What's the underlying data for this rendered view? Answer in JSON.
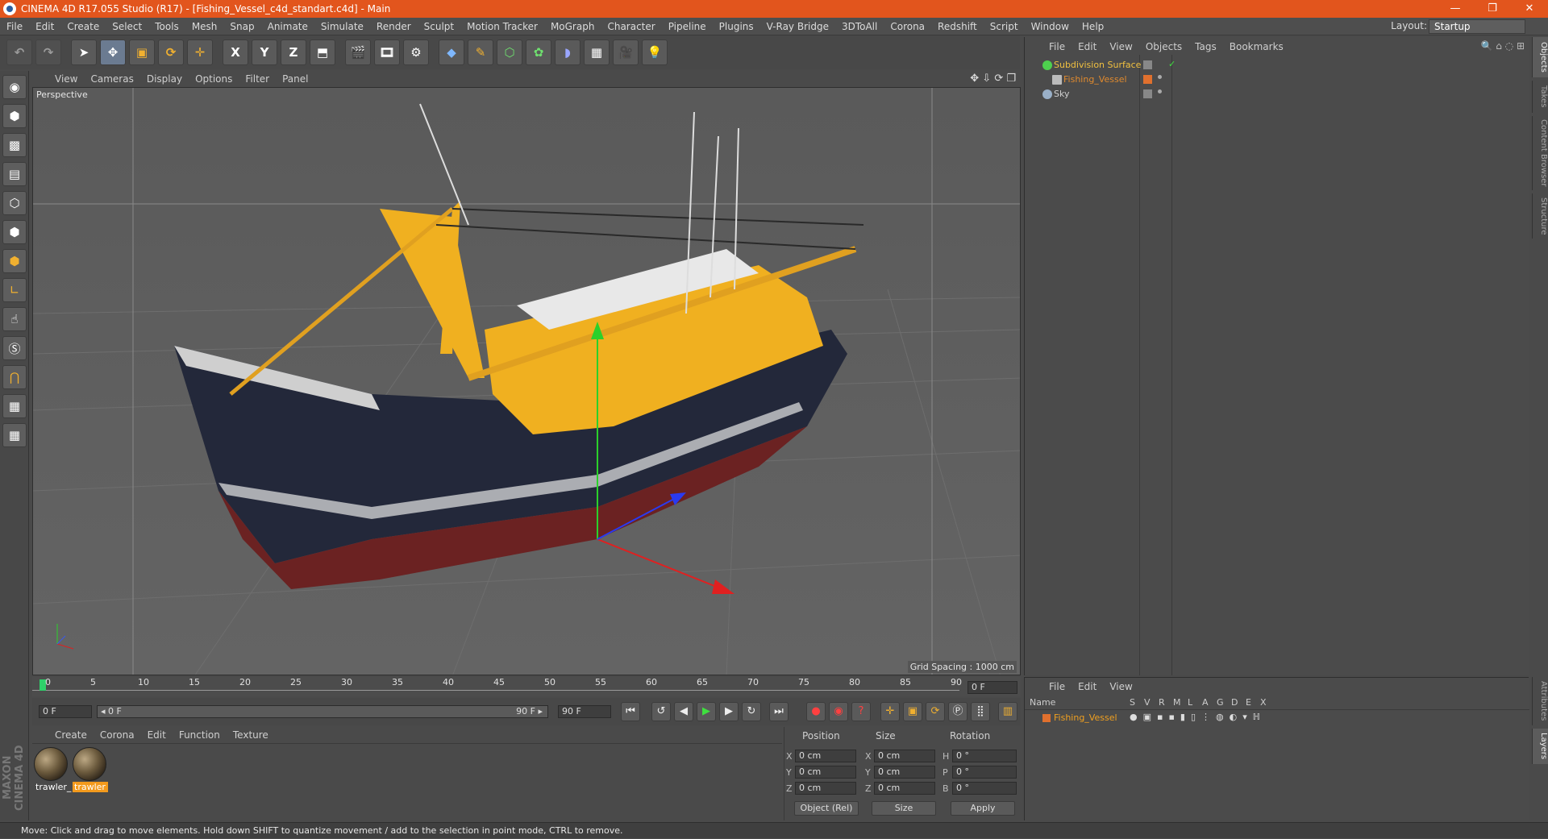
{
  "window": {
    "title": "CINEMA 4D R17.055 Studio (R17) - [Fishing_Vessel_c4d_standart.c4d] - Main",
    "minimize": "—",
    "restore": "❐",
    "close": "✕"
  },
  "menu": [
    "File",
    "Edit",
    "Create",
    "Select",
    "Tools",
    "Mesh",
    "Snap",
    "Animate",
    "Simulate",
    "Render",
    "Sculpt",
    "Motion Tracker",
    "MoGraph",
    "Character",
    "Pipeline",
    "Plugins",
    "V-Ray Bridge",
    "3DToAll",
    "Corona",
    "Redshift",
    "Script",
    "Window",
    "Help"
  ],
  "layout": {
    "label": "Layout:",
    "value": "Startup"
  },
  "toolbar": {
    "axes": [
      "X",
      "Y",
      "Z"
    ]
  },
  "viewport": {
    "menu": [
      "View",
      "Cameras",
      "Display",
      "Options",
      "Filter",
      "Panel"
    ],
    "label": "Perspective",
    "grid_spacing": "Grid Spacing : 1000 cm"
  },
  "timeline": {
    "ticks": [
      "0",
      "5",
      "10",
      "15",
      "20",
      "25",
      "30",
      "35",
      "40",
      "45",
      "50",
      "55",
      "60",
      "65",
      "70",
      "75",
      "80",
      "85",
      "90"
    ],
    "current_frame": "0 F",
    "start_field": "0 F",
    "range_start": "◂ 0 F",
    "range_end": "90 F ▸",
    "end_field": "90 F"
  },
  "material_manager": {
    "menu": [
      "Create",
      "Corona",
      "Edit",
      "Function",
      "Texture"
    ],
    "materials": [
      {
        "label": "trawler_"
      },
      {
        "label": "trawler"
      }
    ]
  },
  "coords": {
    "headers": {
      "position": "Position",
      "size": "Size",
      "rotation": "Rotation"
    },
    "rows": [
      {
        "axis": "X",
        "pos": "0 cm",
        "saxis": "X",
        "size": "0 cm",
        "raxis": "H",
        "rot": "0 °"
      },
      {
        "axis": "Y",
        "pos": "0 cm",
        "saxis": "Y",
        "size": "0 cm",
        "raxis": "P",
        "rot": "0 °"
      },
      {
        "axis": "Z",
        "pos": "0 cm",
        "saxis": "Z",
        "size": "0 cm",
        "raxis": "B",
        "rot": "0 °"
      }
    ],
    "mode": "Object (Rel)",
    "size_mode": "Size",
    "apply": "Apply"
  },
  "object_manager": {
    "menu": [
      "File",
      "Edit",
      "View",
      "Objects",
      "Tags",
      "Bookmarks"
    ],
    "objects": [
      {
        "name": "Subdivision Surface",
        "color": "#f0c040"
      },
      {
        "name": "Fishing_Vessel",
        "color": "#e08a2e"
      },
      {
        "name": "Sky",
        "color": "#9ab0c8"
      }
    ]
  },
  "layer_manager": {
    "menu": [
      "File",
      "Edit",
      "View"
    ],
    "columns": [
      "Name",
      "S",
      "V",
      "R",
      "M",
      "L",
      "A",
      "G",
      "D",
      "E",
      "X"
    ],
    "layer": "Fishing_Vessel"
  },
  "right_tabs": [
    "Objects",
    "Takes",
    "Content Browser",
    "Structure"
  ],
  "right_tabs_bottom": [
    "Attributes",
    "Layers"
  ],
  "status": "Move: Click and drag to move elements. Hold down SHIFT to quantize movement / add to the selection in point mode, CTRL to remove.",
  "brand": "MAXON CINEMA 4D",
  "colors": {
    "title_bar": "#e2551d",
    "accent": "#f39a1d"
  }
}
